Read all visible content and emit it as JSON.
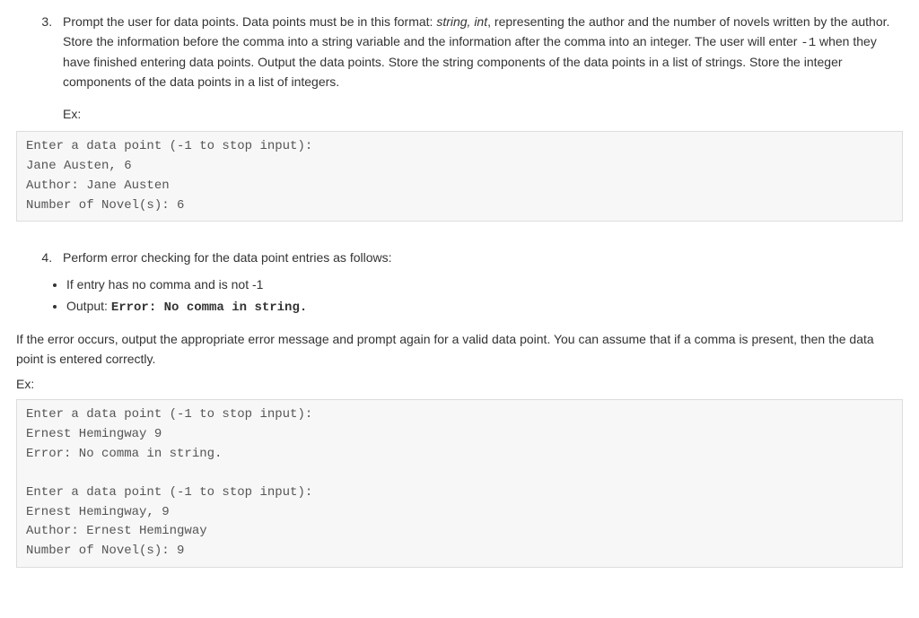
{
  "item3": {
    "number": "3.",
    "text_before_format": "Prompt the user for data points. Data points must be in this format: ",
    "format": "string, int",
    "text_after_format": ", representing the author and the number of novels written by the author. Store the information before the comma into a string variable and the information after the comma into an integer. The user will enter ",
    "sentinel": "-1",
    "text_after_sentinel": " when they have finished entering data points. Output the data points. Store the string components of the data points in a list of strings. Store the integer components of the data points in a list of integers.",
    "ex_label": "Ex:",
    "code": "Enter a data point (-1 to stop input):\nJane Austen, 6\nAuthor: Jane Austen\nNumber of Novel(s): 6"
  },
  "item4": {
    "number": "4.",
    "intro": "Perform error checking for the data point entries as follows:",
    "bullet1": "If entry has no comma and is not -1",
    "bullet2_prefix": "Output: ",
    "bullet2_code": "Error: No comma in string.",
    "error_para": "If the error occurs, output the appropriate error message and prompt again for a valid data point. You can assume that if a comma is present, then the data point is entered correctly.",
    "ex_label": "Ex:",
    "code": "Enter a data point (-1 to stop input):\nErnest Hemingway 9\nError: No comma in string.\n\nEnter a data point (-1 to stop input):\nErnest Hemingway, 9\nAuthor: Ernest Hemingway\nNumber of Novel(s): 9"
  }
}
